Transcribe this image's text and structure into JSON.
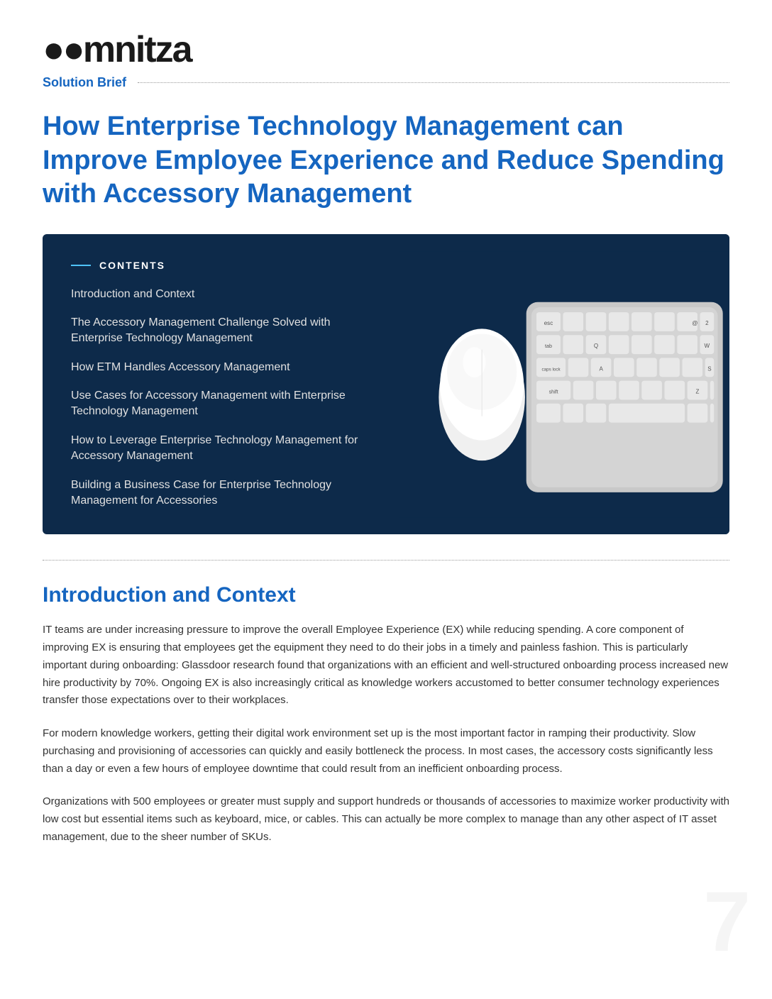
{
  "logo": {
    "text": "omnitza",
    "prefix": "oo"
  },
  "header": {
    "solution_brief_label": "Solution Brief"
  },
  "main_title": "How Enterprise Technology Management can Improve Employee Experience and Reduce Spending with Accessory Management",
  "contents": {
    "header": "CONTENTS",
    "items": [
      {
        "label": "Introduction and Context"
      },
      {
        "label": "The Accessory Management Challenge Solved with Enterprise Technology Management"
      },
      {
        "label": "How ETM Handles Accessory Management"
      },
      {
        "label": "Use Cases for Accessory Management with Enterprise Technology Management"
      },
      {
        "label": "How to Leverage Enterprise Technology Management for Accessory Management"
      },
      {
        "label": "Building a Business Case for Enterprise Technology Management for Accessories"
      }
    ]
  },
  "intro_section": {
    "title": "Introduction and Context",
    "paragraphs": [
      "IT teams are under increasing pressure to improve the overall Employee Experience (EX) while reducing spending. A core component of improving EX is ensuring that employees get the equipment they need to do their jobs in a timely and painless fashion. This is particularly important during onboarding: Glassdoor research found that organizations with an efficient and well-structured onboarding process increased new hire productivity by 70%. Ongoing EX is also increasingly critical as knowledge workers accustomed to better consumer technology experiences transfer those expectations over to their workplaces.",
      "For modern knowledge workers, getting their digital work environment set up is the most important factor in ramping their productivity. Slow purchasing and provisioning of accessories can quickly and easily bottleneck the process. In most cases, the accessory costs significantly less than a day or even a few hours of employee downtime that could result from an inefficient onboarding process.",
      "Organizations with 500 employees or greater must supply and support hundreds or thousands of accessories to maximize worker productivity with low cost but essential items such as keyboard, mice, or cables. This can actually be more complex to manage than any other aspect of IT asset management, due to the sheer number of SKUs."
    ]
  },
  "watermark": "7"
}
